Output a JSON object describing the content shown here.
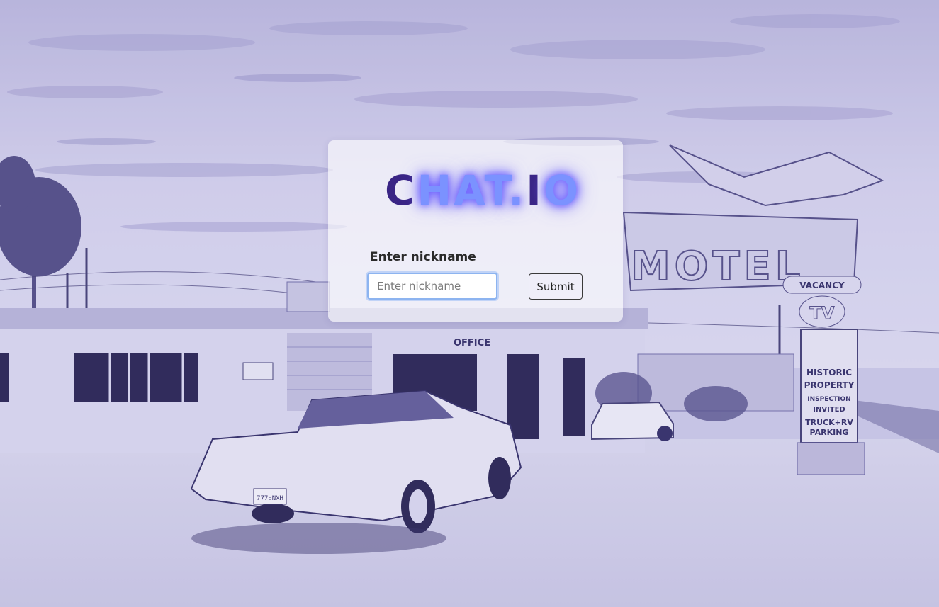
{
  "logo": {
    "part1": "C",
    "part2": "HAT.",
    "part3": "I",
    "part4": "O"
  },
  "form": {
    "label": "Enter nickname",
    "input_value": "",
    "input_placeholder": "Enter nickname",
    "submit_label": "Submit"
  },
  "background": {
    "sign_motel": "MOTEL",
    "sign_vacancy": "VACANCY",
    "sign_tv": "TV",
    "sign_historic": "HISTORIC",
    "sign_property": "PROPERTY",
    "sign_inspection": "INSPECTION",
    "sign_invited": "INVITED",
    "sign_truck_rv": "TRUCK+RV",
    "sign_parking": "PARKING",
    "sign_office": "OFFICE",
    "plate": "777▫NXH"
  },
  "colors": {
    "background_tint": "#c9c6e6",
    "logo_dark": "#3a2585",
    "logo_glow": "#7b92ff",
    "input_focus": "#8db4f0"
  }
}
